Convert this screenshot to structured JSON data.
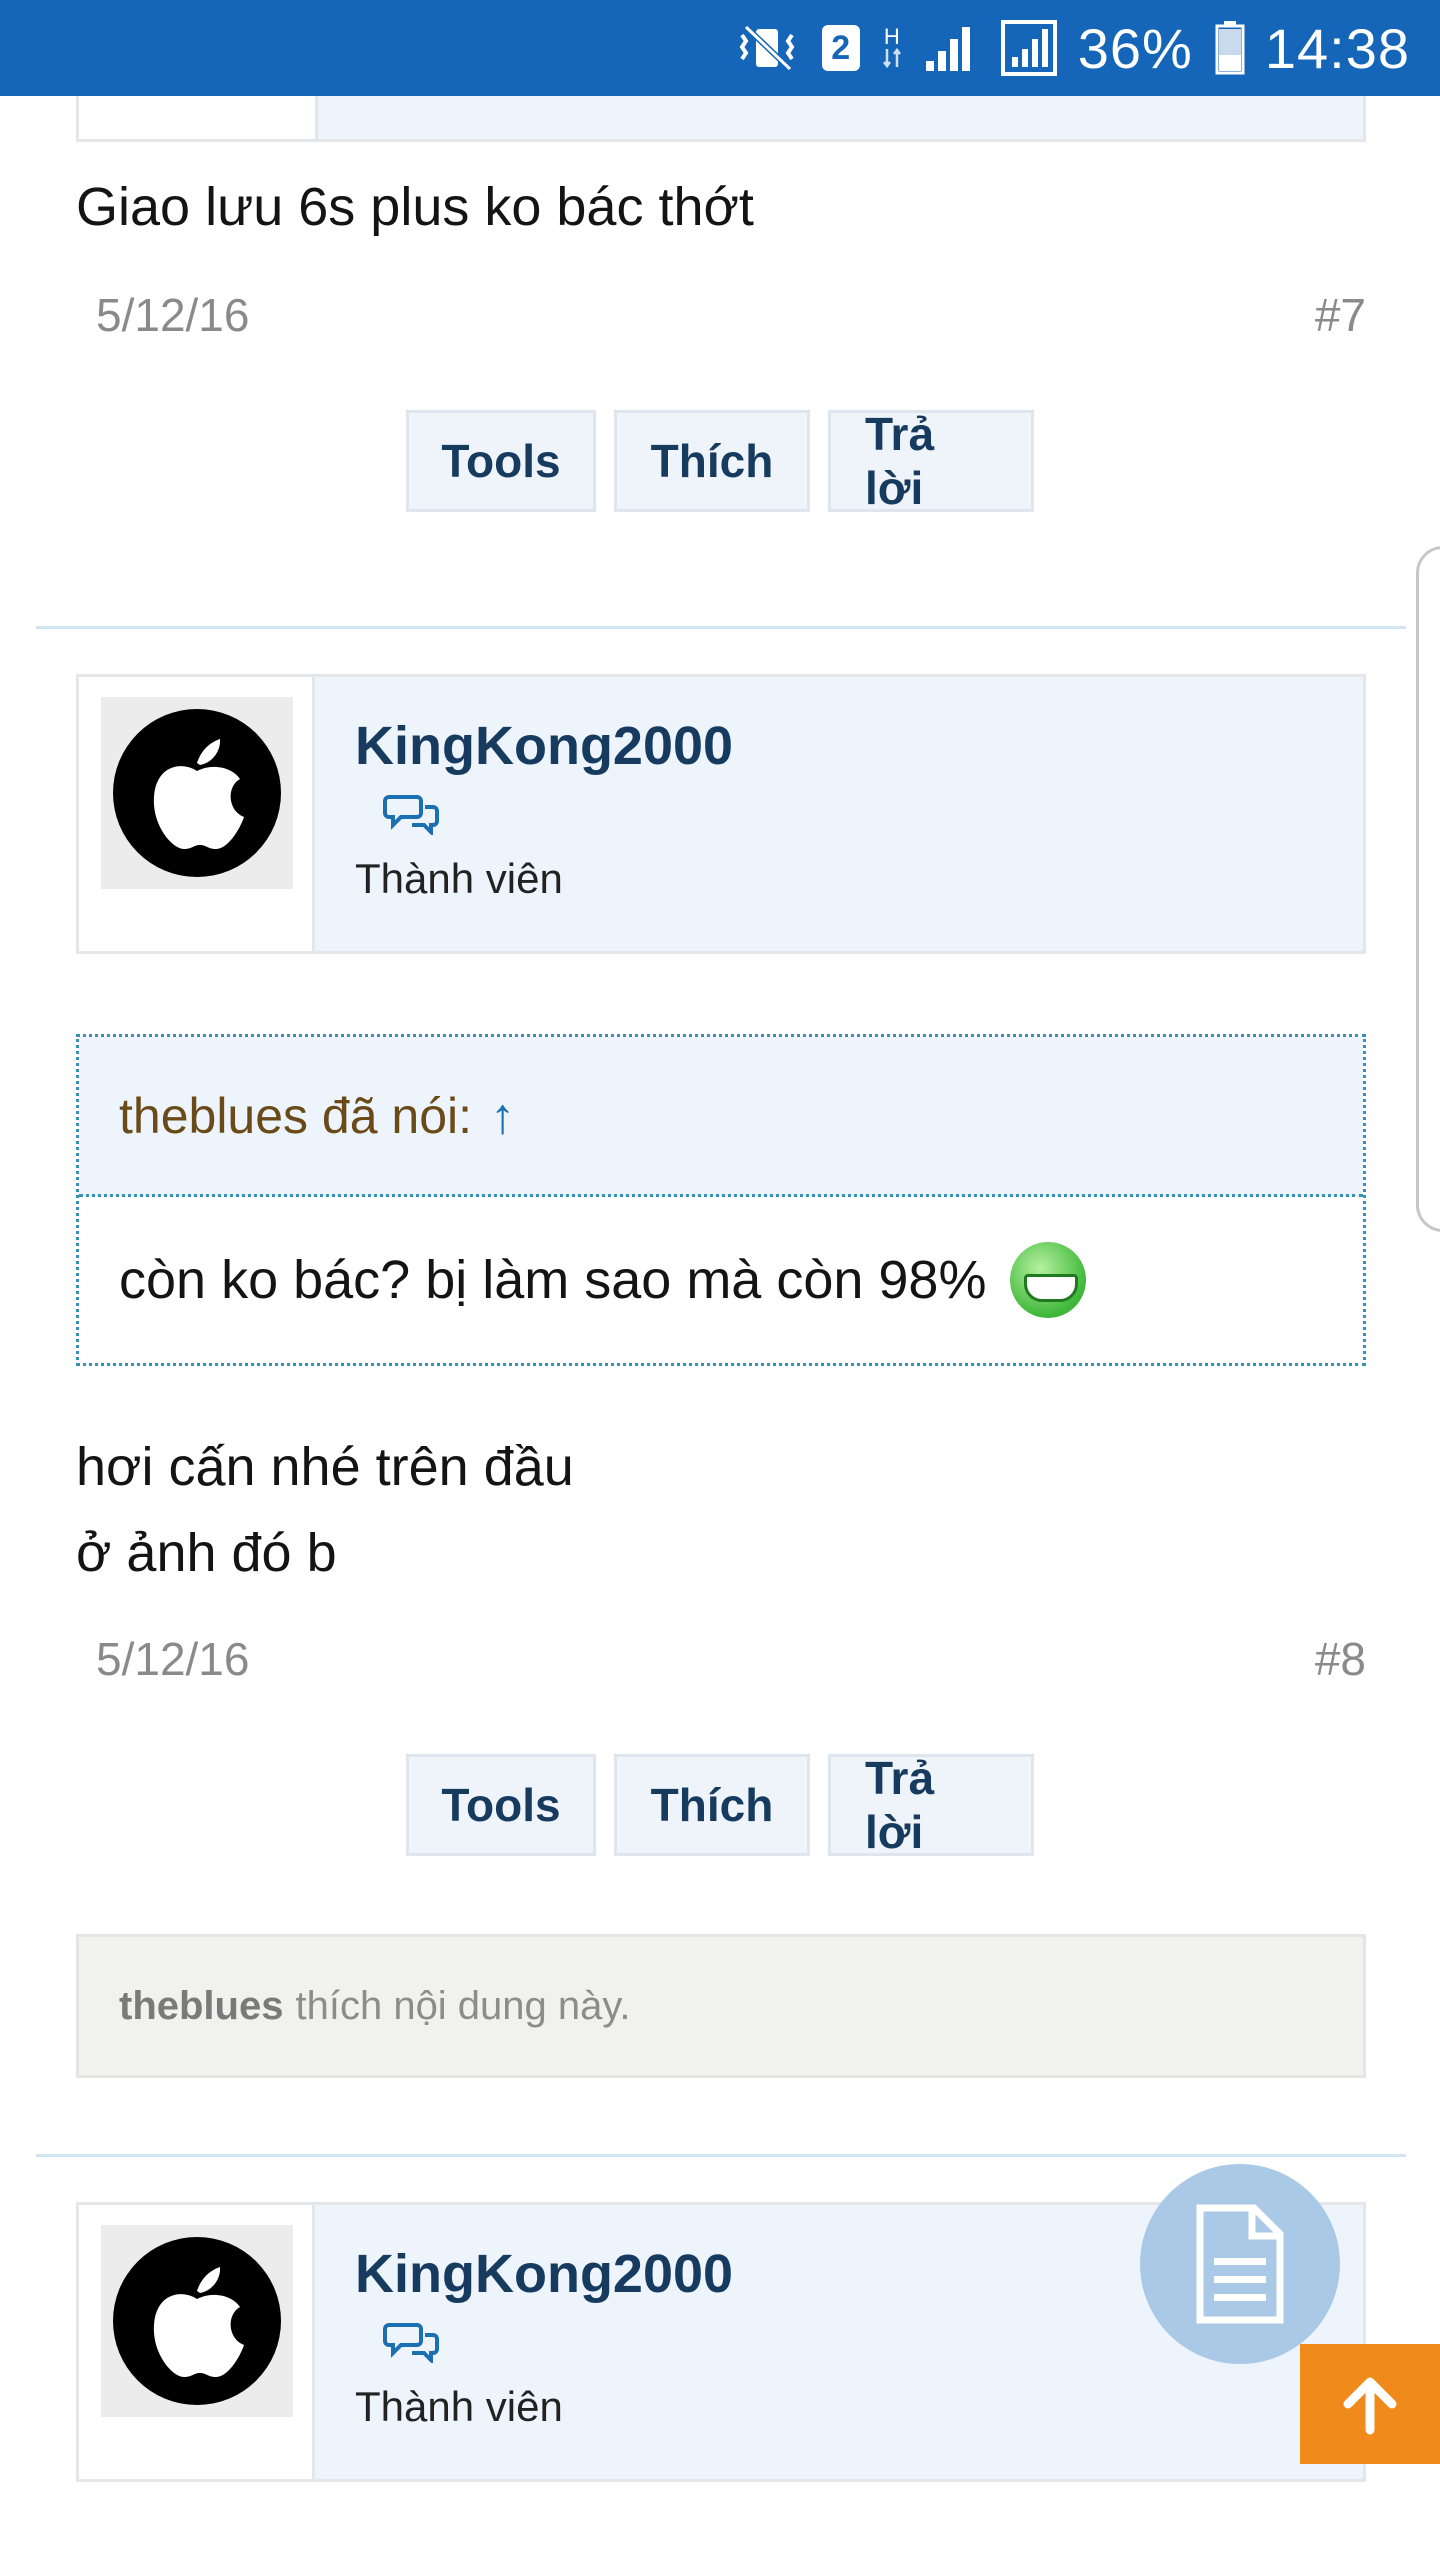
{
  "status_bar": {
    "battery_percent": "36%",
    "time": "14:38",
    "sim_slot": "2",
    "network_type": "H",
    "icons": [
      "mute-vibrate-icon",
      "sim-2-icon",
      "data-arrows-icon",
      "signal-icon",
      "signal-icon-2",
      "battery-icon"
    ]
  },
  "posts": [
    {
      "message": "Giao lưu 6s plus ko bác thớt",
      "date": "5/12/16",
      "number": "#7",
      "actions": {
        "tools": "Tools",
        "like": "Thích",
        "reply": "Trả lời"
      }
    },
    {
      "user": {
        "name": "KingKong2000",
        "role": "Thành viên"
      },
      "quote": {
        "author": "theblues đã nói:",
        "arrow": "↑",
        "text": "còn ko bác? bị làm sao mà còn 98%"
      },
      "message_lines": [
        "hơi cấn nhé trên đầu",
        "ở ảnh đó b"
      ],
      "date": "5/12/16",
      "number": "#8",
      "actions": {
        "tools": "Tools",
        "like": "Thích",
        "reply": "Trả lời"
      },
      "likes": {
        "user": "theblues",
        "text": "thích nội dung này."
      }
    },
    {
      "user": {
        "name": "KingKong2000",
        "role": "Thành viên"
      }
    }
  ],
  "colors": {
    "status_bar": "#1565b8",
    "username": "#173b5e",
    "quote_border": "#3a8fb8",
    "quote_author": "#6b4a1a",
    "scroll_top_button": "#f08a1a",
    "fab": "#a9c9e6"
  }
}
